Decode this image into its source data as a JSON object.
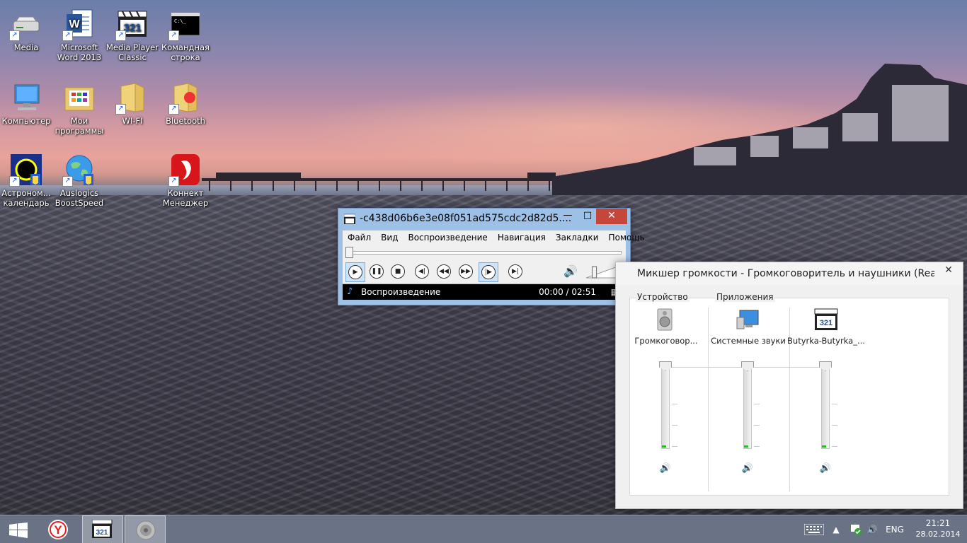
{
  "desktop": {
    "icons": [
      {
        "label": "Media",
        "icon": "drive-icon"
      },
      {
        "label": "Microsoft Word 2013",
        "icon": "word-icon"
      },
      {
        "label": "Media Player Classic",
        "icon": "mpc-icon"
      },
      {
        "label": "Командная строка",
        "icon": "cmd-icon"
      },
      {
        "label": "Компьютер",
        "icon": "computer-icon"
      },
      {
        "label": "Мои программы",
        "icon": "folder-programs-icon"
      },
      {
        "label": "WI-FI",
        "icon": "folder-icon"
      },
      {
        "label": "Bluetooth",
        "icon": "bluetooth-folder-icon"
      },
      {
        "label": "Астроном... календарь",
        "icon": "astronomy-icon"
      },
      {
        "label": "Auslogics BoostSpeed",
        "icon": "globe-icon"
      },
      {
        "label": "Коннект Менеджер",
        "icon": "connect-manager-icon"
      }
    ]
  },
  "mpc": {
    "title": "-c438d06b6e3e08f051ad575cdc2d82d5....",
    "menu": [
      "Файл",
      "Вид",
      "Воспроизведение",
      "Навигация",
      "Закладки",
      "Помощь"
    ],
    "seek_position": 0.0,
    "volume_level": 0.15,
    "status_text": "Воспроизведение",
    "time": "00:00 / 02:51",
    "controls": [
      "play",
      "pause",
      "stop",
      "previous",
      "rewind",
      "forward",
      "next",
      "frame-step"
    ]
  },
  "mixer": {
    "title": "Микшер громкости - Громкоговоритель и наушники (Realtek High Definition Audio)",
    "device_group_label": "Устройство",
    "apps_group_label": "Приложения",
    "channels": [
      {
        "name": "Громкоговор...",
        "icon": "speaker-icon",
        "level": 1.0
      },
      {
        "name": "Системные звуки",
        "icon": "system-sounds-icon",
        "level": 1.0
      },
      {
        "name": "Butyrka-Butyrka_...",
        "icon": "mpc-icon",
        "level": 1.0
      }
    ]
  },
  "taskbar": {
    "items": [
      "start-icon",
      "yandex-browser-icon",
      "mpc-icon",
      "volume-mixer-icon"
    ],
    "language": "ENG",
    "time": "21:21",
    "date": "28.02.2014"
  },
  "colors": {
    "close_red": "#c7463a",
    "mpc_frame": "#9dc0e6",
    "taskbar": "#768096",
    "level_green": "#2fb52f"
  }
}
